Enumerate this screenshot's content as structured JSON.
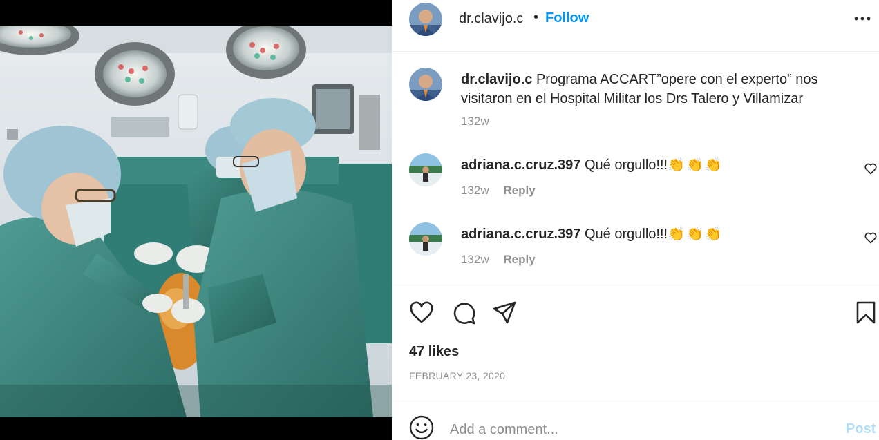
{
  "header": {
    "username": "dr.clavijo.c",
    "separator": "•",
    "follow_label": "Follow",
    "more_icon": "more-horizontal-icon"
  },
  "caption": {
    "username": "dr.clavijo.c",
    "text": "Programa ACCART”opere con el experto” nos visitaron en el Hospital Militar los Drs Talero y Villamizar",
    "time": "132w"
  },
  "comments": [
    {
      "username": "adriana.c.cruz.397",
      "text": "Qué orgullo!!!",
      "emoji": "👏👏👏",
      "time": "132w",
      "reply_label": "Reply"
    },
    {
      "username": "adriana.c.cruz.397",
      "text": "Qué orgullo!!!",
      "emoji": "👏👏👏",
      "time": "132w",
      "reply_label": "Reply"
    }
  ],
  "actions": {
    "icons": [
      "heart-icon",
      "comment-icon",
      "share-icon",
      "bookmark-icon"
    ]
  },
  "likes": "47 likes",
  "date": "FEBRUARY 23, 2020",
  "add_comment": {
    "placeholder": "Add a comment...",
    "post_label": "Post"
  },
  "colors": {
    "accent": "#0095f6",
    "post_disabled": "#b2dffc",
    "text": "#262626",
    "muted": "#8e8e8e"
  }
}
